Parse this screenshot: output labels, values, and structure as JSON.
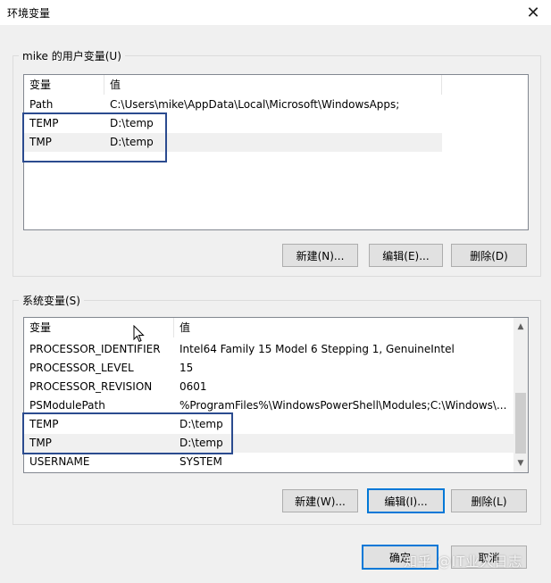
{
  "window": {
    "title": "环境变量",
    "close_icon": "close-icon"
  },
  "user_vars": {
    "group_label": "mike 的用户变量(U)",
    "col_name": "变量",
    "col_value": "值",
    "rows": [
      {
        "name": "Path",
        "value": "C:\\Users\\mike\\AppData\\Local\\Microsoft\\WindowsApps;"
      },
      {
        "name": "TEMP",
        "value": "D:\\temp"
      },
      {
        "name": "TMP",
        "value": "D:\\temp"
      }
    ],
    "new_label": "新建(N)...",
    "edit_label": "编辑(E)...",
    "delete_label": "删除(D)"
  },
  "system_vars": {
    "group_label": "系统变量(S)",
    "col_name": "变量",
    "col_value": "值",
    "rows": [
      {
        "name": "PROCESSOR_IDENTIFIER",
        "value": "Intel64 Family 15 Model 6 Stepping 1, GenuineIntel"
      },
      {
        "name": "PROCESSOR_LEVEL",
        "value": "15"
      },
      {
        "name": "PROCESSOR_REVISION",
        "value": "0601"
      },
      {
        "name": "PSModulePath",
        "value": "%ProgramFiles%\\WindowsPowerShell\\Modules;C:\\Windows\\..."
      },
      {
        "name": "TEMP",
        "value": "D:\\temp"
      },
      {
        "name": "TMP",
        "value": "D:\\temp"
      },
      {
        "name": "USERNAME",
        "value": "SYSTEM"
      }
    ],
    "new_label": "新建(W)...",
    "edit_label": "编辑(I)...",
    "delete_label": "删除(L)"
  },
  "footer": {
    "ok_label": "确定",
    "cancel_label": "取消"
  },
  "watermark": "知乎 @IT业人日志",
  "colors": {
    "highlight_border": "#2b4b8f",
    "focus_border": "#0078d7"
  }
}
